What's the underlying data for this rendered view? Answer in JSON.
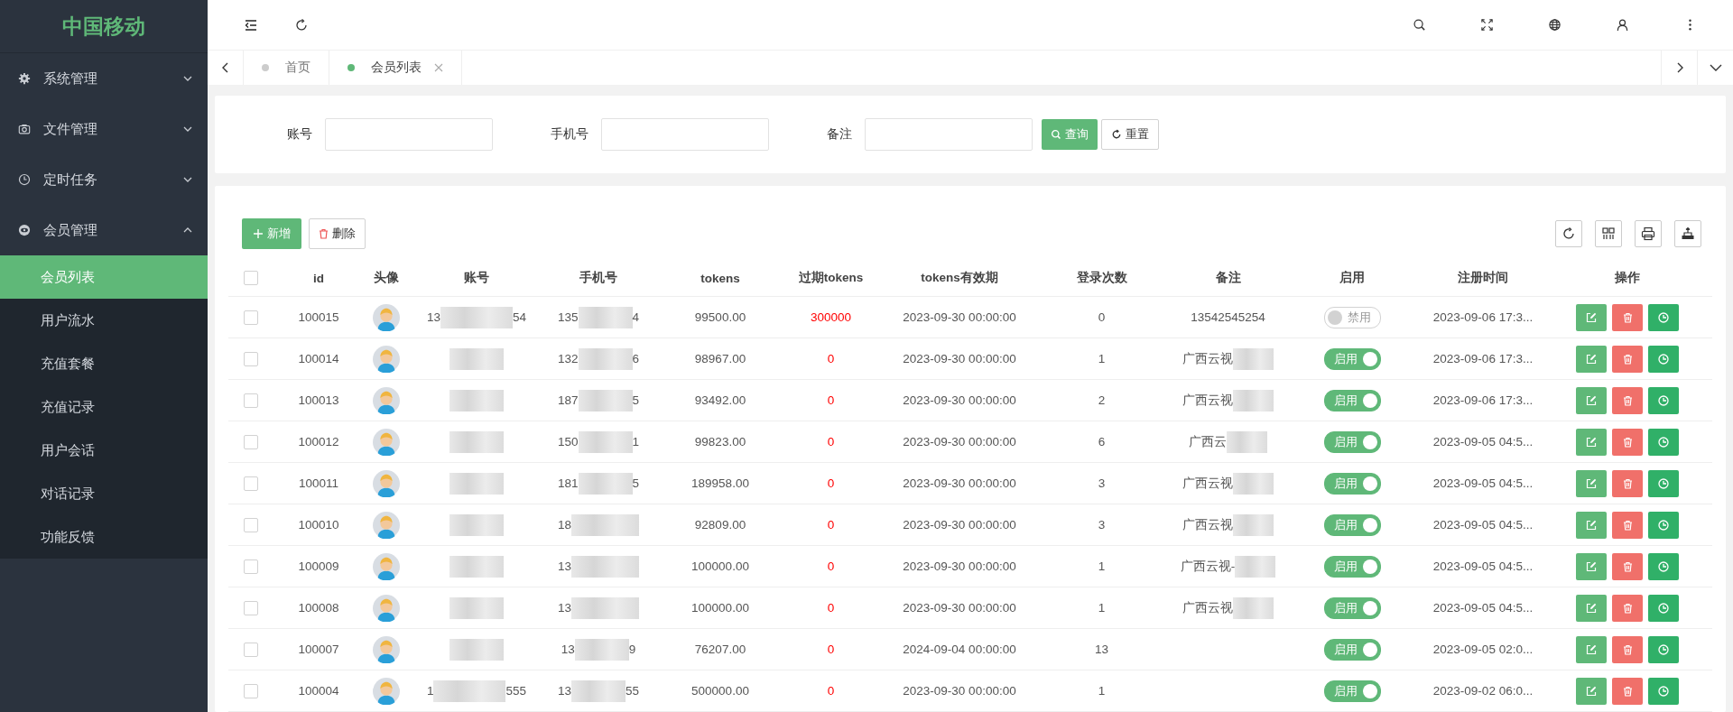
{
  "logo": "中国移动",
  "menu": [
    {
      "label": "系统管理",
      "expanded": false
    },
    {
      "label": "文件管理",
      "expanded": false
    },
    {
      "label": "定时任务",
      "expanded": false
    },
    {
      "label": "会员管理",
      "expanded": true,
      "children": [
        {
          "label": "会员列表",
          "selected": true
        },
        {
          "label": "用户流水",
          "selected": false
        },
        {
          "label": "充值套餐",
          "selected": false
        },
        {
          "label": "充值记录",
          "selected": false
        },
        {
          "label": "用户会话",
          "selected": false
        },
        {
          "label": "对话记录",
          "selected": false
        },
        {
          "label": "功能反馈",
          "selected": false
        }
      ]
    }
  ],
  "tabs": [
    {
      "label": "首页",
      "selected": false,
      "closable": false
    },
    {
      "label": "会员列表",
      "selected": true,
      "closable": true
    }
  ],
  "search": {
    "fields": [
      {
        "label": "账号"
      },
      {
        "label": "手机号"
      },
      {
        "label": "备注"
      }
    ],
    "query_button": "查询",
    "reset_button": "重置"
  },
  "toolbar": {
    "add_button": "新增",
    "delete_button": "删除"
  },
  "table": {
    "all_selected": false,
    "columns": [
      "id",
      "头像",
      "账号",
      "手机号",
      "tokens",
      "过期tokens",
      "tokens有效期",
      "登录次数",
      "备注",
      "启用",
      "注册时间",
      "操作"
    ],
    "rows": [
      {
        "selected": false,
        "id": "100015",
        "account": {
          "start": "13",
          "end": "54"
        },
        "phone": {
          "start": "135",
          "end": "4"
        },
        "tokens": "99500.00",
        "expired_tokens": "300000",
        "valid_until": "2023-09-30 00:00:00",
        "logins": "0",
        "remark": {
          "text": "13542545254",
          "blurred": false
        },
        "enabled": false,
        "switch_text": "禁用",
        "registered": "2023-09-06 17:3..."
      },
      {
        "selected": false,
        "id": "100014",
        "phone": {
          "start": "132",
          "end": "6"
        },
        "tokens": "98967.00",
        "expired_tokens": "0",
        "valid_until": "2023-09-30 00:00:00",
        "logins": "1",
        "remark": {
          "text": "广西云视",
          "blurred": true
        },
        "enabled": true,
        "switch_text": "启用",
        "registered": "2023-09-06 17:3..."
      },
      {
        "selected": false,
        "id": "100013",
        "phone": {
          "start": "187",
          "end": "5"
        },
        "tokens": "93492.00",
        "expired_tokens": "0",
        "valid_until": "2023-09-30 00:00:00",
        "logins": "2",
        "remark": {
          "text": "广西云视",
          "blurred": true
        },
        "enabled": true,
        "switch_text": "启用",
        "registered": "2023-09-06 17:3..."
      },
      {
        "selected": false,
        "id": "100012",
        "phone": {
          "start": "150",
          "end": "1"
        },
        "tokens": "99823.00",
        "expired_tokens": "0",
        "valid_until": "2023-09-30 00:00:00",
        "logins": "6",
        "remark": {
          "text": "广西云",
          "blurred": true
        },
        "enabled": true,
        "switch_text": "启用",
        "registered": "2023-09-05 04:5..."
      },
      {
        "selected": false,
        "id": "100011",
        "phone": {
          "start": "181",
          "end": "5"
        },
        "tokens": "189958.00",
        "expired_tokens": "0",
        "valid_until": "2023-09-30 00:00:00",
        "logins": "3",
        "remark": {
          "text": "广西云视",
          "blurred": true
        },
        "enabled": true,
        "switch_text": "启用",
        "registered": "2023-09-05 04:5..."
      },
      {
        "selected": false,
        "id": "100010",
        "phone": {
          "start": "18"
        },
        "tokens": "92809.00",
        "expired_tokens": "0",
        "valid_until": "2023-09-30 00:00:00",
        "logins": "3",
        "remark": {
          "text": "广西云视",
          "blurred": true
        },
        "enabled": true,
        "switch_text": "启用",
        "registered": "2023-09-05 04:5..."
      },
      {
        "selected": false,
        "id": "100009",
        "phone": {
          "start": "13"
        },
        "tokens": "100000.00",
        "expired_tokens": "0",
        "valid_until": "2023-09-30 00:00:00",
        "logins": "1",
        "remark": {
          "text": "广西云视-",
          "blurred": true
        },
        "enabled": true,
        "switch_text": "启用",
        "registered": "2023-09-05 04:5..."
      },
      {
        "selected": false,
        "id": "100008",
        "phone": {
          "start": "13"
        },
        "tokens": "100000.00",
        "expired_tokens": "0",
        "valid_until": "2023-09-30 00:00:00",
        "logins": "1",
        "remark": {
          "text": "广西云视",
          "blurred": true
        },
        "enabled": true,
        "switch_text": "启用",
        "registered": "2023-09-05 04:5..."
      },
      {
        "selected": false,
        "id": "100007",
        "phone": {
          "start": "13",
          "end": "9"
        },
        "tokens": "76207.00",
        "expired_tokens": "0",
        "valid_until": "2024-09-04 00:00:00",
        "logins": "13",
        "enabled": true,
        "switch_text": "启用",
        "registered": "2023-09-05 02:0..."
      },
      {
        "selected": false,
        "id": "100004",
        "account": {
          "start": "1",
          "end": "555"
        },
        "phone": {
          "start": "13",
          "end": "55"
        },
        "tokens": "500000.00",
        "expired_tokens": "0",
        "valid_until": "2023-09-30 00:00:00",
        "logins": "1",
        "enabled": true,
        "switch_text": "启用",
        "registered": "2023-09-02 06:0..."
      }
    ]
  }
}
